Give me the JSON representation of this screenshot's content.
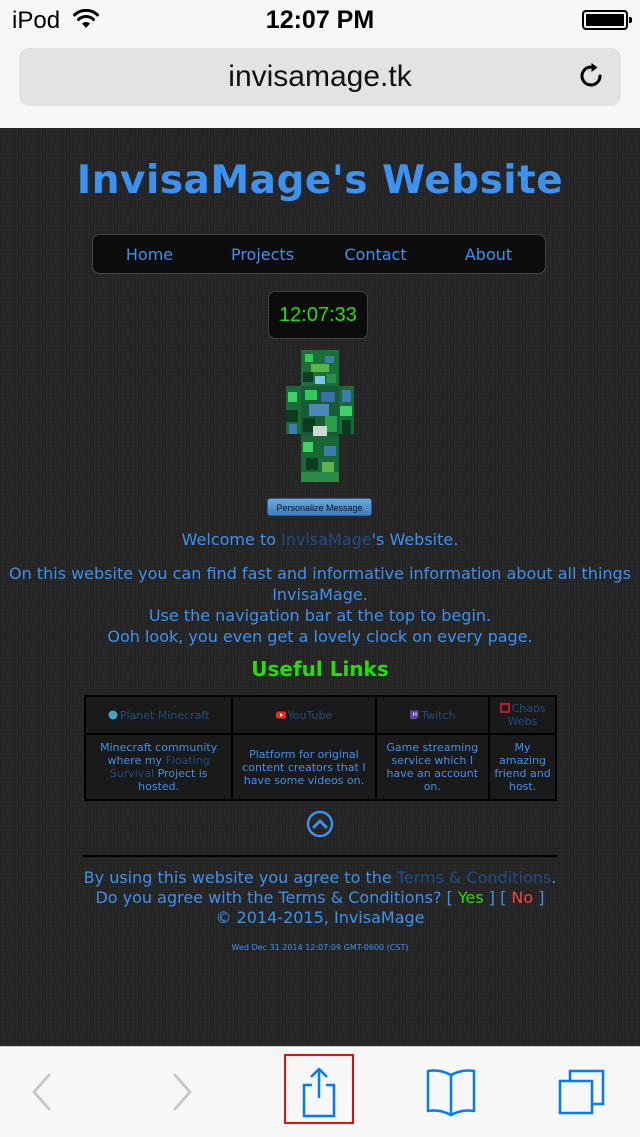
{
  "status_bar": {
    "carrier": "iPod",
    "time": "12:07 PM"
  },
  "browser": {
    "url": "invisamage.tk"
  },
  "site": {
    "title": "InvisaMage's Website",
    "nav": [
      "Home",
      "Projects",
      "Contact",
      "About"
    ],
    "clock": "12:07:33",
    "personalize_button": "Personalize Message",
    "welcome": {
      "prefix": "Welcome to ",
      "name": "InvisaMage",
      "suffix": "'s Website."
    },
    "intro_lines": [
      "On this website you can find fast and informative information about all things",
      "InvisaMage.",
      "Use the navigation bar at the top to begin.",
      "Ooh look, you even get a lovely clock on every page."
    ],
    "links_heading": "Useful Links",
    "links": [
      {
        "name": "Planet Minecraft",
        "icon": "globe-icon"
      },
      {
        "name": "YouTube",
        "icon": "youtube-icon"
      },
      {
        "name": "Twitch",
        "icon": "twitch-icon"
      },
      {
        "name": "Chaos Webs",
        "icon": "chaos-webs-icon"
      }
    ],
    "link_descriptions": {
      "planet_minecraft": {
        "before": "Minecraft community where my ",
        "highlight": "Floating Survival",
        "after": " Project is hosted."
      },
      "youtube": "Platform for original content creators that I have some videos on.",
      "twitch": "Game streaming service which I have an account on.",
      "chaos_webs": "My amazing friend and host."
    },
    "footer": {
      "agree_prefix": "By using this website you agree to the ",
      "terms_link": "Terms & Conditions",
      "agree_suffix": ".",
      "question": "Do you agree with the Terms & Conditions? ",
      "yes_open": "[ ",
      "yes": "Yes",
      "yes_close": " ]",
      "no_open": " [ ",
      "no": "No",
      "no_close": " ]",
      "copyright": "© 2014-2015, InvisaMage"
    },
    "datestamp": "Wed Dec 31 2014 12:07:09 GMT-0600 (CST)"
  },
  "colors": {
    "accent_blue": "#3c92f0",
    "clock_green": "#22e000",
    "no_red": "#ff4040",
    "page_bg": "#262626",
    "ios_blue": "#007aff"
  }
}
